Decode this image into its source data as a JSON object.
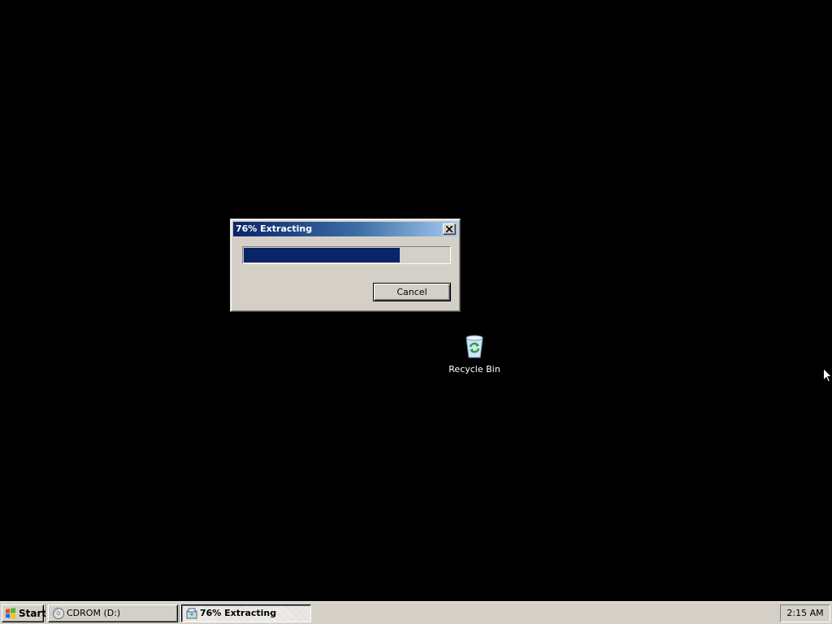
{
  "dialog": {
    "title": "76% Extracting",
    "progress_percent": 76,
    "cancel_label": "Cancel"
  },
  "desktop": {
    "icons": [
      {
        "label": "Recycle Bin",
        "icon": "recycle-bin-icon"
      }
    ]
  },
  "taskbar": {
    "start_label": "Start",
    "buttons": [
      {
        "label": "CDROM (D:)",
        "icon": "cdrom-drive-icon",
        "active": false
      },
      {
        "label": "76% Extracting",
        "icon": "extract-icon",
        "active": true
      }
    ],
    "clock": "2:15 AM"
  },
  "colors": {
    "desktop_background": "#000000",
    "progress_fill": "#0a246a",
    "titlebar_start": "#0a246a",
    "titlebar_end": "#a6caf0",
    "window_face": "#d4d0c8"
  }
}
